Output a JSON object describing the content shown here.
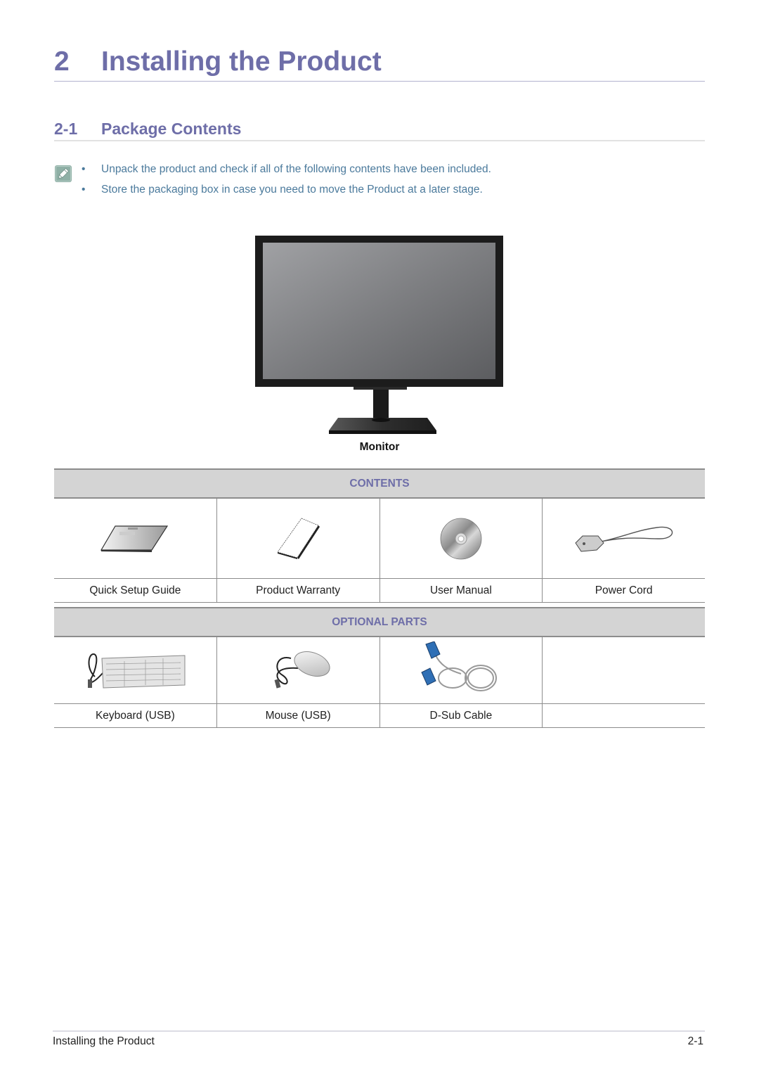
{
  "chapter": {
    "number": "2",
    "title": "Installing the Product"
  },
  "section": {
    "number": "2-1",
    "title": "Package Contents"
  },
  "note": {
    "icon": "note-pencil-icon",
    "bullet": "•",
    "items": [
      "Unpack the product and check if all of the following contents have been included.",
      "Store the packaging box in case you need to move the Product at a later stage."
    ]
  },
  "main_item": {
    "icon": "monitor-image",
    "label": "Monitor"
  },
  "contents": {
    "header": "CONTENTS",
    "items": [
      {
        "label": "Quick Setup Guide",
        "icon": "quick-setup-guide-image"
      },
      {
        "label": "Product Warranty",
        "icon": "warranty-booklet-image"
      },
      {
        "label": "User Manual",
        "icon": "cd-disc-image"
      },
      {
        "label": "Power Cord",
        "icon": "power-cord-image"
      }
    ]
  },
  "optional_parts": {
    "header": "OPTIONAL PARTS",
    "items": [
      {
        "label": "Keyboard (USB)",
        "icon": "keyboard-image"
      },
      {
        "label": "Mouse (USB)",
        "icon": "mouse-image"
      },
      {
        "label": "D-Sub Cable",
        "icon": "dsub-cable-image"
      },
      {
        "label": "",
        "icon": ""
      }
    ]
  },
  "footer": {
    "left": "Installing the Product",
    "right": "2-1"
  },
  "colors": {
    "heading": "#6e6ea8",
    "note_text": "#4b7a9c",
    "table_header_bg": "#d4d4d4",
    "note_icon_bg": "#8fb0a6"
  }
}
